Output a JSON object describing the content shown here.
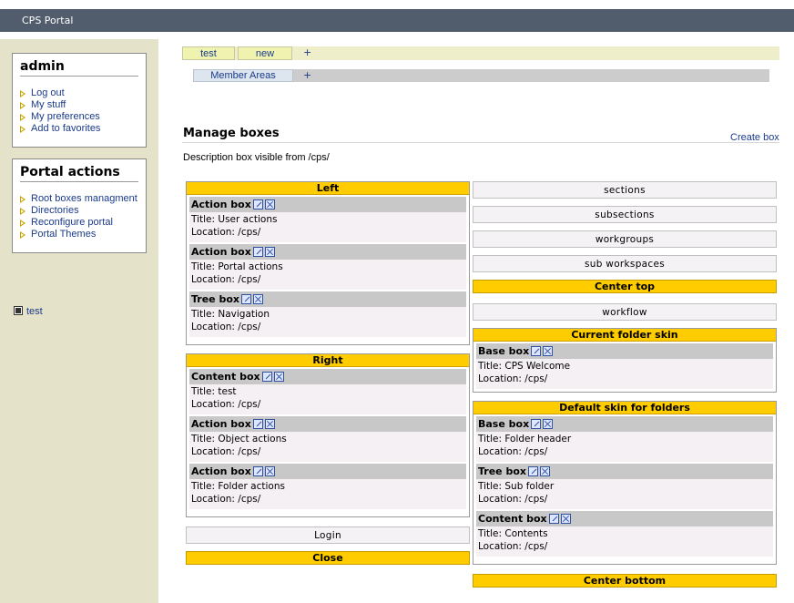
{
  "app": {
    "title": "CPS Portal"
  },
  "sidebar": {
    "user_box": {
      "title": "admin",
      "items": [
        {
          "label": "Log out"
        },
        {
          "label": "My stuff"
        },
        {
          "label": "My preferences"
        },
        {
          "label": "Add to favorites"
        }
      ]
    },
    "actions_box": {
      "title": "Portal actions",
      "items": [
        {
          "label": "Root boxes managment"
        },
        {
          "label": "Directories"
        },
        {
          "label": "Reconfigure portal"
        },
        {
          "label": "Portal Themes"
        }
      ]
    },
    "tree_item": "test"
  },
  "tabs": {
    "row1": [
      "test",
      "new"
    ],
    "row1_add": "+",
    "row2": [
      "Member Areas"
    ],
    "row2_add": "+"
  },
  "main": {
    "title": "Manage boxes",
    "create_link": "Create box",
    "description": "Description box visible from /cps/"
  },
  "slots": {
    "left": {
      "header": "Left",
      "boxes": [
        {
          "type": "Action box",
          "title": "Title: User actions",
          "location": "Location: /cps/"
        },
        {
          "type": "Action box",
          "title": "Title: Portal actions",
          "location": "Location: /cps/"
        },
        {
          "type": "Tree box",
          "title": "Title: Navigation",
          "location": "Location: /cps/"
        }
      ]
    },
    "right": {
      "header": "Right",
      "boxes": [
        {
          "type": "Content box",
          "title": "Title: test",
          "location": "Location: /cps/"
        },
        {
          "type": "Action box",
          "title": "Title: Object actions",
          "location": "Location: /cps/"
        },
        {
          "type": "Action box",
          "title": "Title: Folder actions",
          "location": "Location: /cps/"
        }
      ]
    },
    "login": "Login",
    "close": "Close",
    "sections": "sections",
    "subsections": "subsections",
    "workgroups": "workgroups",
    "sub_workspaces": "sub workspaces",
    "center_top": "Center top",
    "workflow": "workflow",
    "current_folder_skin": {
      "header": "Current folder skin",
      "boxes": [
        {
          "type": "Base box",
          "title": "Title: CPS Welcome",
          "location": "Location: /cps/"
        }
      ]
    },
    "default_skin": {
      "header": "Default skin for folders",
      "boxes": [
        {
          "type": "Base box",
          "title": "Title: Folder header",
          "location": "Location: /cps/"
        },
        {
          "type": "Tree box",
          "title": "Title: Sub folder",
          "location": "Location: /cps/"
        },
        {
          "type": "Content box",
          "title": "Title: Contents",
          "location": "Location: /cps/"
        }
      ]
    },
    "center_bottom": "Center bottom"
  },
  "colors": {
    "topbar": "#515d6d",
    "sidebar": "#e4e2c8",
    "slot_header": "#ffcc00",
    "link": "#1a3a8a"
  }
}
